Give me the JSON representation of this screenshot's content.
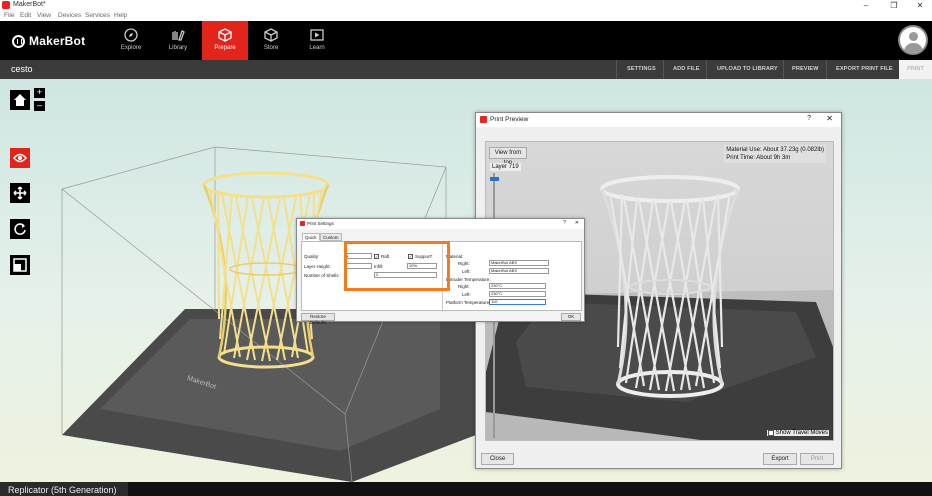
{
  "window": {
    "title": "MakerBot*"
  },
  "menu": [
    "File",
    "Edit",
    "View",
    "Devices",
    "Services",
    "Help"
  ],
  "brand": "MakerBot",
  "nav_tabs": [
    {
      "label": "Explore",
      "icon": "compass-icon"
    },
    {
      "label": "Library",
      "icon": "library-icon"
    },
    {
      "label": "Prepare",
      "icon": "cube-icon",
      "active": true
    },
    {
      "label": "Store",
      "icon": "store-box-icon"
    },
    {
      "label": "Learn",
      "icon": "video-icon"
    }
  ],
  "project": {
    "name": "cesto",
    "actions": [
      "SETTINGS",
      "ADD FILE",
      "UPLOAD TO LIBRARY",
      "PREVIEW",
      "EXPORT PRINT FILE"
    ],
    "print": "PRINT"
  },
  "build_plate_brand": "MakerBot",
  "preview_dialog": {
    "title": "Print Preview",
    "help": "?",
    "view_from_top": "View from top",
    "layer": "Layer 719",
    "material_use": "Material Use: About 37.23g (0.082lb)",
    "print_time": "Print Time: About 9h 3m",
    "show_travel_moves": "Show Travel Moves",
    "close": "Close",
    "export": "Export",
    "print": "Print"
  },
  "settings_dialog": {
    "title": "Print Settings",
    "help": "?",
    "tabs": [
      "Quick",
      "Custom"
    ],
    "quality_label": "Quality:",
    "layer_height_label": "Layer Height:",
    "shells_label": "Number of Shells:",
    "raft": "Raft",
    "support": "Support*",
    "infill_label": "Infill:",
    "infill_value": "10%",
    "shells_value": "2",
    "material_label": "Material:",
    "right_label": "Right:",
    "left_label": "Left:",
    "right_material": "MakerBot ABS",
    "left_material": "MakerBot ABS",
    "extruder_temp_label": "Extruder Temperature:",
    "right_temp": "230°C",
    "left_temp": "230°C",
    "platform_temp_label": "Platform Temperature:*",
    "platform_temp": "110",
    "restore_defaults": "Restore Defaults",
    "ok": "OK"
  },
  "status": {
    "machine": "Replicator (5th Generation)"
  },
  "colors": {
    "accent": "#e2251b",
    "highlight": "#f07d22",
    "model": "#f4e08c"
  }
}
